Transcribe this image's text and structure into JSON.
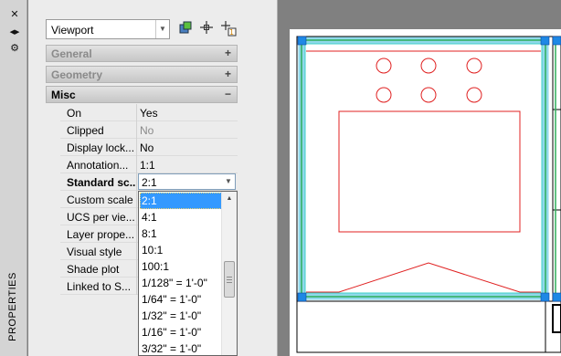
{
  "strip": {
    "close_glyph": "✕",
    "autohide_glyph": "◀▶",
    "properties_glyph": "⚙",
    "title": "PROPERTIES"
  },
  "palette": {
    "object_selector": "Viewport",
    "tools": [
      "quick-select-icon",
      "select-objects-icon",
      "toggle-pickadd-icon"
    ],
    "sections": [
      {
        "title": "General",
        "state": "+"
      },
      {
        "title": "Geometry",
        "state": "+"
      },
      {
        "title": "Misc",
        "state": "−"
      }
    ],
    "properties": [
      {
        "name": "On",
        "value": "Yes"
      },
      {
        "name": "Clipped",
        "value": "No"
      },
      {
        "name": "Display lock...",
        "value": "No"
      },
      {
        "name": "Annotation...",
        "value": "1:1"
      },
      {
        "name": "Standard sc...",
        "value": "2:1"
      },
      {
        "name": "Custom scale",
        "value": ""
      },
      {
        "name": "UCS per vie...",
        "value": ""
      },
      {
        "name": "Layer prope...",
        "value": ""
      },
      {
        "name": "Visual style",
        "value": ""
      },
      {
        "name": "Shade plot",
        "value": ""
      },
      {
        "name": "Linked to S...",
        "value": ""
      }
    ],
    "scale_combo": "2:1",
    "scale_options": [
      "2:1",
      "4:1",
      "8:1",
      "10:1",
      "100:1",
      "1/128\" = 1'-0\"",
      "1/64\" = 1'-0\"",
      "1/32\" = 1'-0\"",
      "1/16\" = 1'-0\"",
      "3/32\" = 1'-0\""
    ],
    "selected_option": "2:1"
  },
  "colors": {
    "accent_selection": "#3399ff",
    "drawing_red": "#e02020",
    "viewport_cyan": "#3fd0c8",
    "viewport_green": "#2fae5a",
    "grip_blue": "#1e88e5"
  }
}
